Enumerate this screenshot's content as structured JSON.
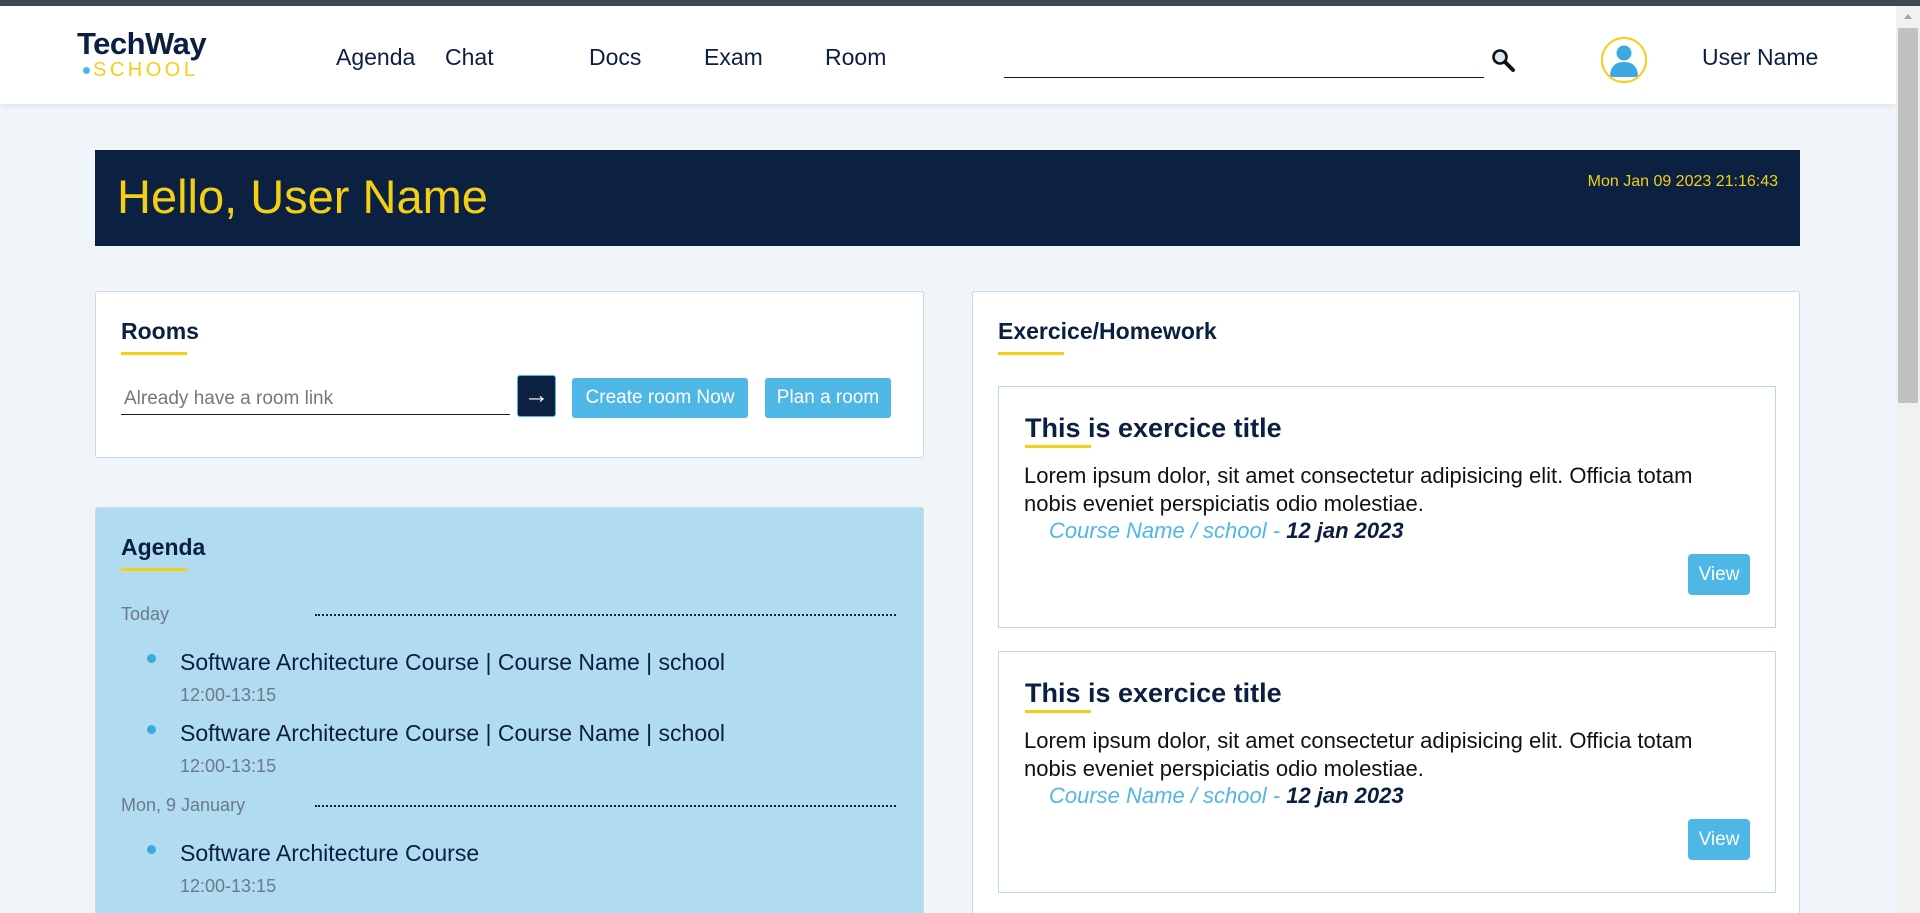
{
  "app": {
    "logo_top": "TechWay",
    "logo_bottom": "SCHOOL"
  },
  "nav": {
    "links": [
      "Agenda",
      "Chat",
      "Docs",
      "Exam",
      "Room"
    ],
    "search_value": "",
    "user_name": "User Name"
  },
  "hero": {
    "greeting": "Hello, User Name",
    "datetime": "Mon Jan 09 2023 21:16:43"
  },
  "rooms": {
    "title": "Rooms",
    "link_placeholder": "Already have a room link",
    "arrow_label": "→",
    "create_label": "Create room Now",
    "plan_label": "Plan a room"
  },
  "agenda": {
    "title": "Agenda",
    "days": [
      {
        "label": "Today",
        "events": [
          {
            "title": "Software Architecture Course | Course Name | school",
            "time": "12:00-13:15"
          },
          {
            "title": "Software Architecture Course | Course Name | school",
            "time": "12:00-13:15"
          }
        ]
      },
      {
        "label": "Mon, 9 January",
        "events": [
          {
            "title": "Software Architecture Course",
            "time": "12:00-13:15"
          }
        ]
      }
    ]
  },
  "exercises": {
    "title": "Exercice/Homework",
    "items": [
      {
        "title": "This is exercice title",
        "description": "Lorem ipsum dolor, sit amet consectetur adipisicing elit. Officia totam nobis eveniet perspiciatis odio molestiae.",
        "course": "Course Name / school - ",
        "date": "12 jan 2023",
        "view_label": "View"
      },
      {
        "title": "This is exercice title",
        "description": "Lorem ipsum dolor, sit amet consectetur adipisicing elit. Officia totam nobis eveniet perspiciatis odio molestiae.",
        "course": "Course Name / school - ",
        "date": "12 jan 2023",
        "view_label": "View"
      }
    ]
  },
  "colors": {
    "navy": "#0c2142",
    "yellow": "#f3cf16",
    "accent_blue": "#4fb7e6",
    "agenda_bg": "#b0dbf1",
    "page_bg": "#f0f5f9"
  },
  "icons": {
    "search": "search-icon",
    "avatar": "user-avatar-icon",
    "arrow": "arrow-right-icon"
  }
}
